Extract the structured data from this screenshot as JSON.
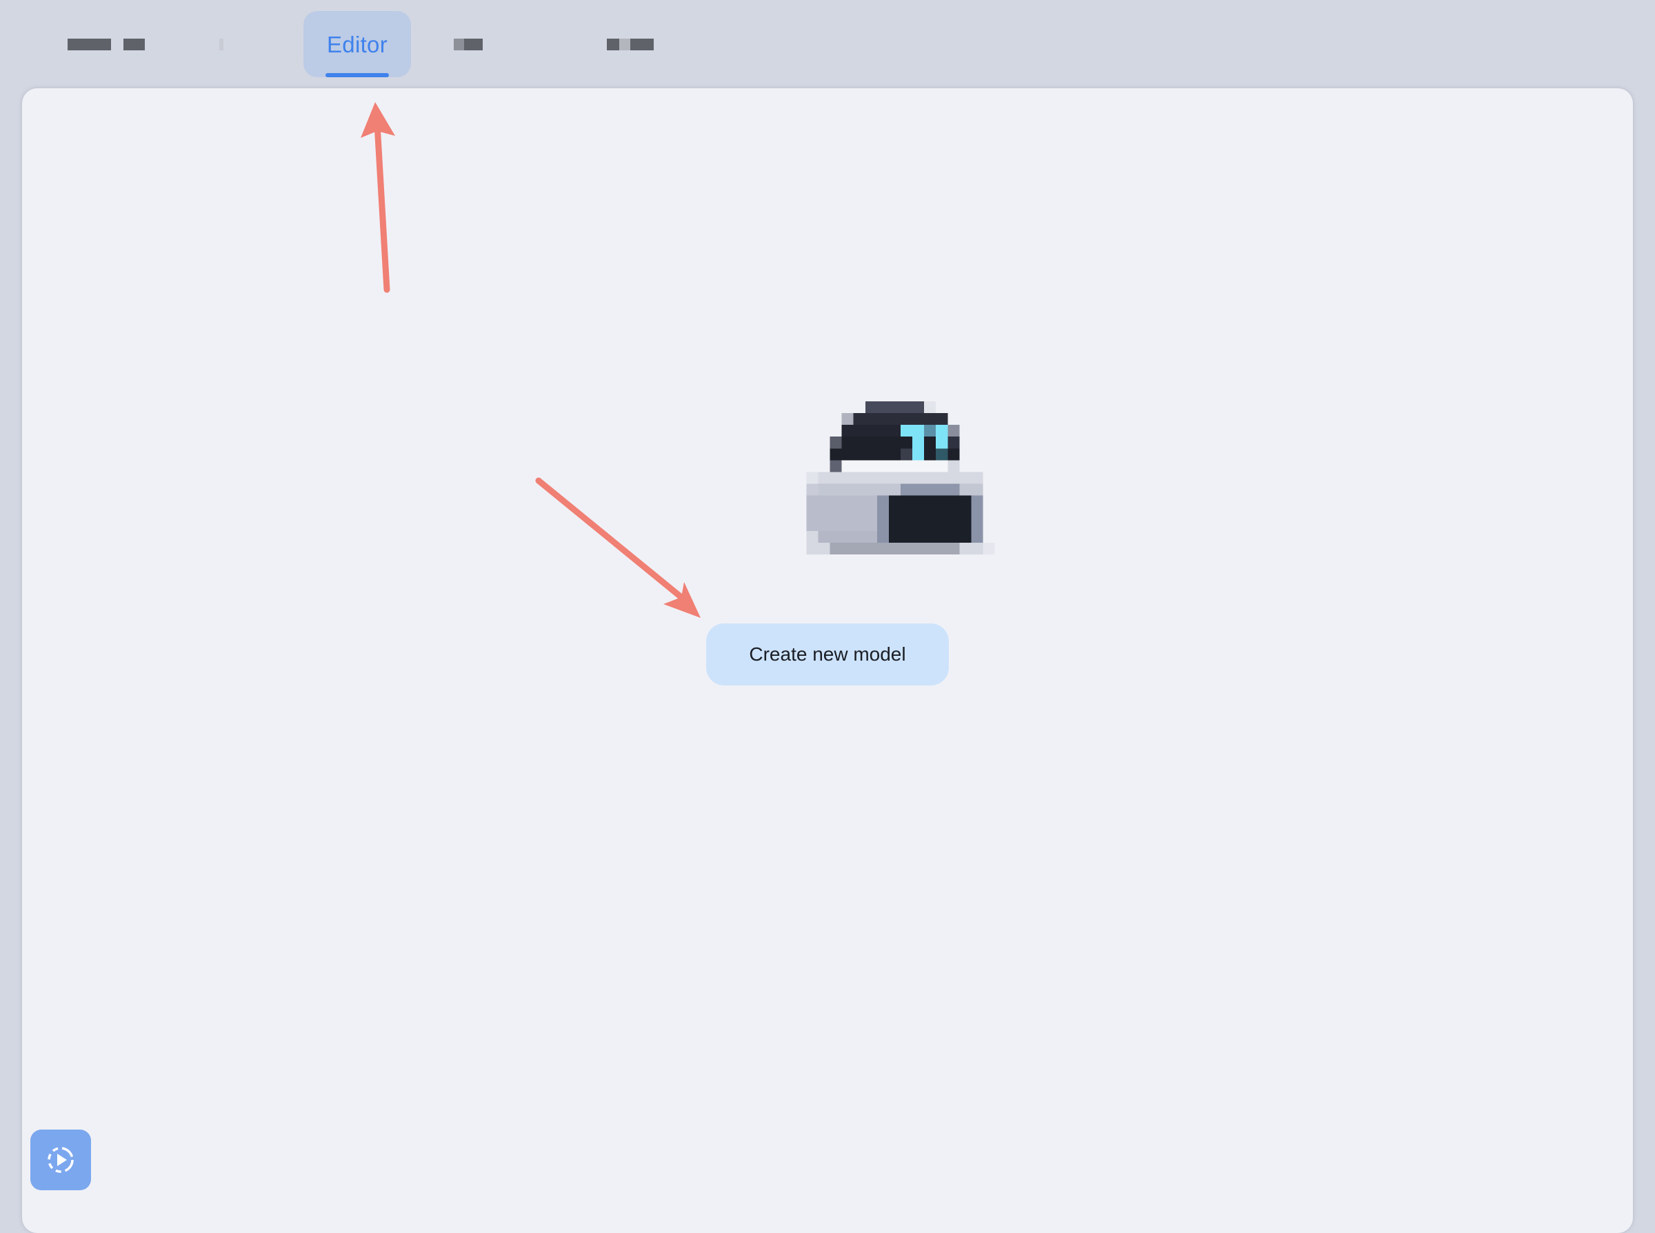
{
  "tabs": [
    {
      "label": "",
      "redacted": true
    },
    {
      "label": "",
      "redacted": true
    },
    {
      "label": "Editor",
      "active": true
    },
    {
      "label": "",
      "redacted": true
    },
    {
      "label": "",
      "redacted": true
    }
  ],
  "main": {
    "mascot_icon": "robot-mascot-icon",
    "create_button_label": "Create new model"
  },
  "corner_button": {
    "icon": "replay-dashed-circle-icon"
  },
  "colors": {
    "accent": "#3f82ec",
    "annotation_arrow": "#f07f74",
    "active_tab_bg": "#bccbe6",
    "create_button_bg": "#cde3fb",
    "corner_button_bg": "#7ba7ee"
  }
}
